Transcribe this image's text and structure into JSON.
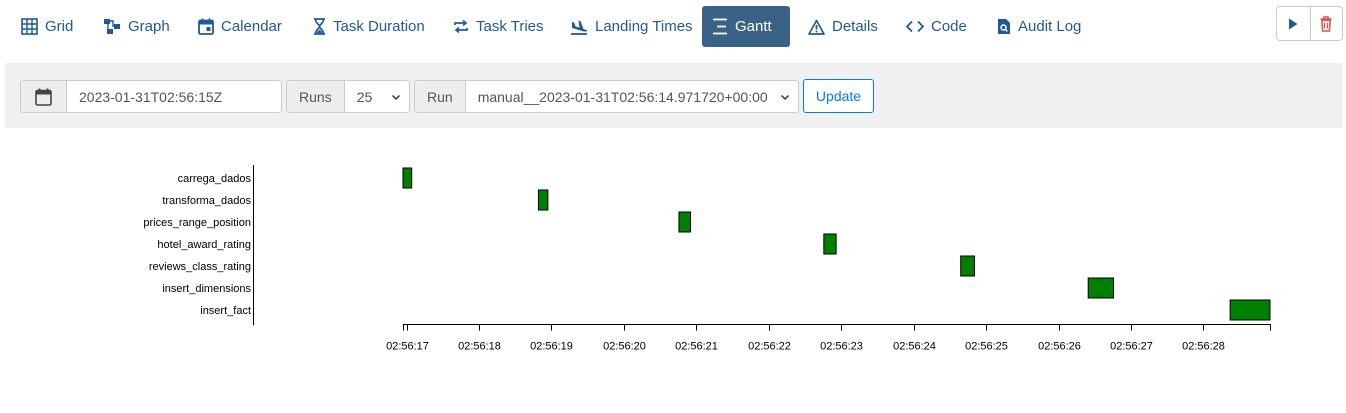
{
  "nav": {
    "tabs": [
      {
        "label": "Grid",
        "icon": "grid-icon",
        "active": false
      },
      {
        "label": "Graph",
        "icon": "graph-icon",
        "active": false
      },
      {
        "label": "Calendar",
        "icon": "calendar-icon",
        "active": false
      },
      {
        "label": "Task Duration",
        "icon": "hourglass-icon",
        "active": false
      },
      {
        "label": "Task Tries",
        "icon": "retry-icon",
        "active": false
      },
      {
        "label": "Landing Times",
        "icon": "plane-landing-icon",
        "active": false
      },
      {
        "label": "Gantt",
        "icon": "gantt-icon",
        "active": true
      },
      {
        "label": "Details",
        "icon": "warning-triangle-icon",
        "active": false
      },
      {
        "label": "Code",
        "icon": "code-icon",
        "active": false
      },
      {
        "label": "Audit Log",
        "icon": "file-search-icon",
        "active": false
      }
    ],
    "actions": [
      {
        "icon": "play-icon",
        "color": "#1f5a96"
      },
      {
        "icon": "trash-icon",
        "color": "#d9534f"
      }
    ]
  },
  "filters": {
    "base_date": "2023-01-31T02:56:15Z",
    "runs_label": "Runs",
    "runs_value": "25",
    "run_label": "Run",
    "run_value": "manual__2023-01-31T02:56:14.971720+00:00",
    "update_label": "Update"
  },
  "chart_data": {
    "type": "gantt",
    "bar_color": "#008000",
    "tasks": [
      {
        "name": "carrega_dados",
        "start": "02:56:16.95",
        "end": "02:56:17.07"
      },
      {
        "name": "transforma_dados",
        "start": "02:56:18.82",
        "end": "02:56:18.95"
      },
      {
        "name": "prices_range_position",
        "start": "02:56:20.76",
        "end": "02:56:20.92"
      },
      {
        "name": "hotel_award_rating",
        "start": "02:56:22.76",
        "end": "02:56:22.93"
      },
      {
        "name": "reviews_class_rating",
        "start": "02:56:24.65",
        "end": "02:56:24.84"
      },
      {
        "name": "insert_dimensions",
        "start": "02:56:26.41",
        "end": "02:56:26.76"
      },
      {
        "name": "insert_fact",
        "start": "02:56:28.37",
        "end": "02:56:28.92"
      }
    ],
    "x_ticks": [
      "02:56:17",
      "02:56:18",
      "02:56:19",
      "02:56:20",
      "02:56:21",
      "02:56:22",
      "02:56:23",
      "02:56:24",
      "02:56:25",
      "02:56:26",
      "02:56:27",
      "02:56:28"
    ],
    "xlim": [
      "02:56:16.95",
      "02:56:28.92"
    ]
  }
}
